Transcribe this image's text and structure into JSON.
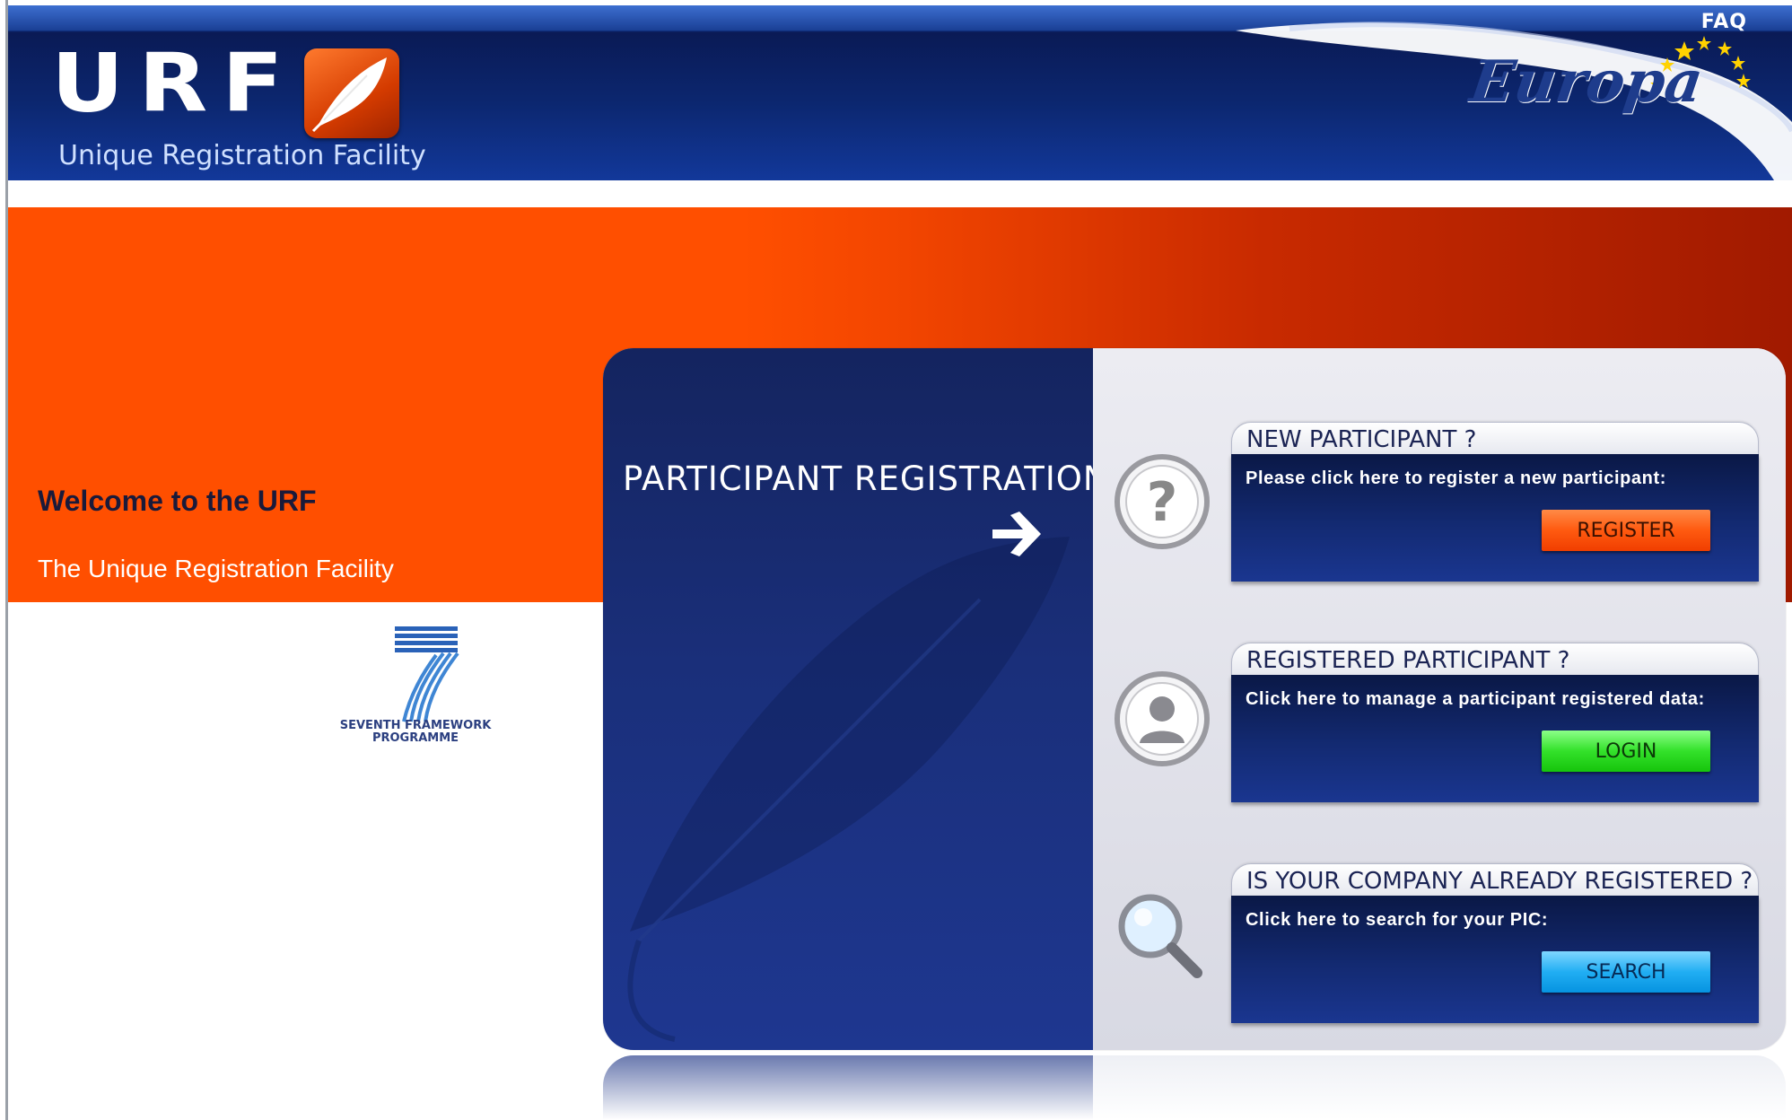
{
  "header": {
    "faq_label": "FAQ",
    "logo_text": "URF",
    "logo_subtitle": "Unique Registration Facility",
    "europa_label": "Europa"
  },
  "welcome": {
    "title": "Welcome to the URF",
    "subtitle": "The Unique Registration Facility"
  },
  "fp7": {
    "caption_line1": "SEVENTH FRAMEWORK",
    "caption_line2": "PROGRAMME"
  },
  "panel": {
    "title": "PARTICIPANT REGISTRATION"
  },
  "cards": [
    {
      "heading": "NEW PARTICIPANT ?",
      "description": "Please click here to register a new participant:",
      "button": "REGISTER",
      "icon": "question-icon"
    },
    {
      "heading": "REGISTERED PARTICIPANT ?",
      "description": "Click here to manage a participant registered data:",
      "button": "LOGIN",
      "icon": "user-icon"
    },
    {
      "heading": "IS YOUR COMPANY ALREADY REGISTERED ?",
      "description": "Click here to search for your PIC:",
      "button": "SEARCH",
      "icon": "magnifier-icon"
    }
  ],
  "colors": {
    "header_blue": "#0c2770",
    "orange": "#ff4f00",
    "panel_blue": "#1a2f7a",
    "register_button": "#ff5a10",
    "login_button": "#33e12a",
    "search_button": "#21aef3"
  }
}
